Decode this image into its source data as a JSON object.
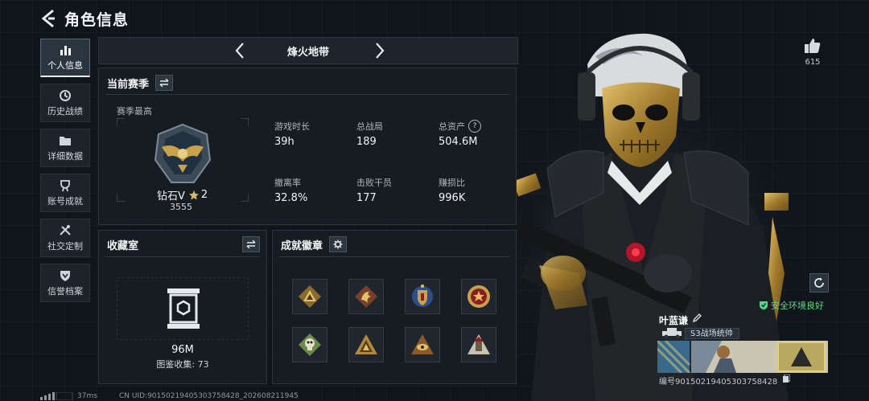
{
  "header": {
    "title": "角色信息"
  },
  "sidebar": {
    "items": [
      {
        "label": "个人信息",
        "icon": "bar-chart-icon",
        "active": true
      },
      {
        "label": "历史战绩",
        "icon": "history-icon",
        "active": false
      },
      {
        "label": "详细数据",
        "icon": "folder-icon",
        "active": false
      },
      {
        "label": "账号成就",
        "icon": "achievement-icon",
        "active": false
      },
      {
        "label": "社交定制",
        "icon": "tools-icon",
        "active": false
      },
      {
        "label": "信誉档案",
        "icon": "shield-icon",
        "active": false
      }
    ]
  },
  "season": {
    "name": "烽火地带"
  },
  "current_season": {
    "title": "当前赛季",
    "peak_label": "赛季最高",
    "rank": "钻石V",
    "stars": "2",
    "rank_score": "3555",
    "stats": [
      {
        "label": "游戏时长",
        "value": "39h"
      },
      {
        "label": "总战局",
        "value": "189"
      },
      {
        "label": "总资产",
        "value": "504.6M",
        "help": "?"
      },
      {
        "label": "撤离率",
        "value": "32.8%"
      },
      {
        "label": "击败干员",
        "value": "177"
      },
      {
        "label": "赚损比",
        "value": "996K"
      }
    ]
  },
  "collection": {
    "title": "收藏室",
    "value": "96M",
    "sub_label": "图鉴收集: 73"
  },
  "achievements": {
    "title": "成就徽章",
    "badges": [
      "triangle-badge-icon",
      "dragon-badge-icon",
      "shield-badge-icon",
      "medal-badge-icon",
      "skull-badge-icon",
      "pyramid-badge-icon",
      "eye-pyramid-badge-icon",
      "tower-badge-icon"
    ]
  },
  "profile": {
    "likes": "615",
    "safe_env": "安全环境良好",
    "player_name": "叶蓝谦",
    "player_title": "S3战场统帅",
    "player_id": "编号9015021940530375842​8"
  },
  "footer": {
    "ping": "37ms",
    "uid": "CN UID:9015021940530375842​8_202608211945"
  },
  "colors": {
    "accent_green": "#5fd38a",
    "panel_bg": "#161c22",
    "gold": "#c8a24a"
  }
}
